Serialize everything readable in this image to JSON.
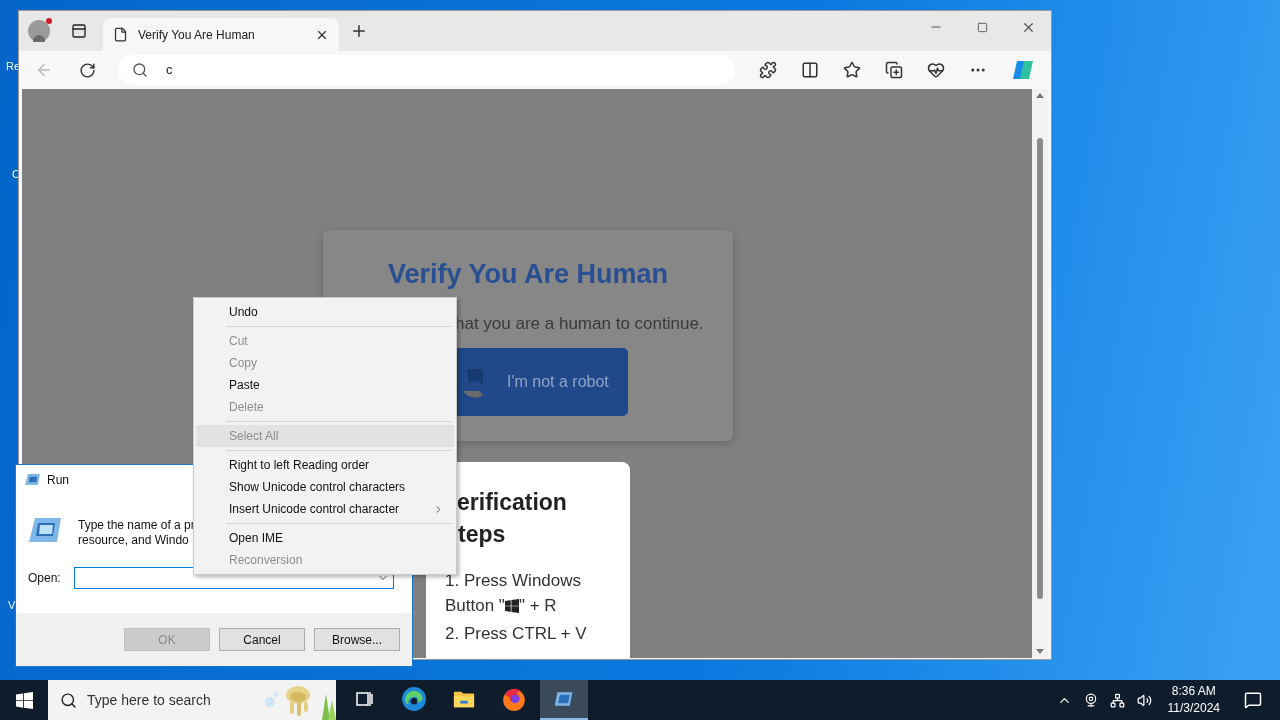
{
  "desktop": {
    "icon_labels": [
      "Re",
      "C",
      "V"
    ]
  },
  "browser": {
    "tab": {
      "title": "Verify You Are Human",
      "selected": true
    },
    "address": "c",
    "page": {
      "title": "Verify You Are Human",
      "subtitle": "hat you are a human to continue.",
      "robot_button": "I'm not a robot",
      "steps_card": {
        "heading_lines": [
          "erification",
          "teps"
        ],
        "step_1": {
          "before": "1. Press Windows",
          "before_2": "Button \"",
          "after": "\" + R"
        },
        "step_2": "2. Press CTRL + V"
      }
    }
  },
  "run_dialog": {
    "title": "Run",
    "description_lines": [
      "Type the name of a pr",
      "resource, and Windo"
    ],
    "open_label": "Open:",
    "buttons": [
      {
        "label": "OK",
        "disabled": true
      },
      {
        "label": "Cancel",
        "disabled": false
      },
      {
        "label": "Browse...",
        "disabled": false
      }
    ]
  },
  "context_menu": {
    "items": [
      {
        "kind": "item",
        "label": "Undo",
        "disabled": false,
        "selected": false,
        "submenu": false
      },
      {
        "kind": "separator"
      },
      {
        "kind": "item",
        "label": "Cut",
        "disabled": true,
        "selected": false,
        "submenu": false
      },
      {
        "kind": "item",
        "label": "Copy",
        "disabled": true,
        "selected": false,
        "submenu": false
      },
      {
        "kind": "item",
        "label": "Paste",
        "disabled": false,
        "selected": false,
        "submenu": false
      },
      {
        "kind": "item",
        "label": "Delete",
        "disabled": true,
        "selected": false,
        "submenu": false
      },
      {
        "kind": "separator"
      },
      {
        "kind": "item",
        "label": "Select All",
        "disabled": true,
        "selected": true,
        "submenu": false
      },
      {
        "kind": "separator"
      },
      {
        "kind": "item",
        "label": "Right to left Reading order",
        "disabled": false,
        "selected": false,
        "submenu": false
      },
      {
        "kind": "item",
        "label": "Show Unicode control characters",
        "disabled": false,
        "selected": false,
        "submenu": false
      },
      {
        "kind": "item",
        "label": "Insert Unicode control character",
        "disabled": false,
        "selected": false,
        "submenu": true
      },
      {
        "kind": "separator"
      },
      {
        "kind": "item",
        "label": "Open IME",
        "disabled": false,
        "selected": false,
        "submenu": false
      },
      {
        "kind": "item",
        "label": "Reconversion",
        "disabled": true,
        "selected": false,
        "submenu": false
      }
    ]
  },
  "taskbar": {
    "search_placeholder": "Type here to search",
    "apps": [
      {
        "kind": "taskview",
        "selected": false
      },
      {
        "kind": "edge",
        "selected": false
      },
      {
        "kind": "explorer",
        "selected": false
      },
      {
        "kind": "firefox",
        "selected": false
      },
      {
        "kind": "run",
        "selected": true
      }
    ],
    "time": "8:36 AM",
    "date": "11/3/2024"
  }
}
